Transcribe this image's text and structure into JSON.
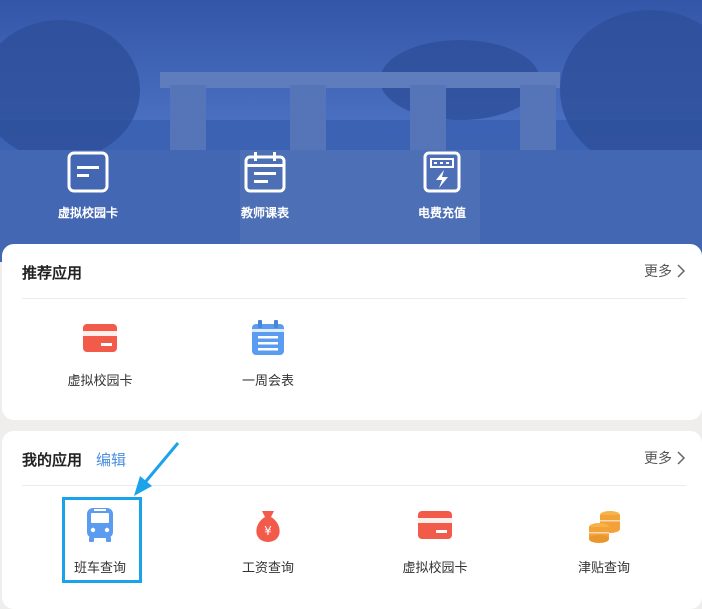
{
  "hero": {
    "quick_actions": [
      {
        "label": "虚拟校园卡",
        "icon": "card-icon"
      },
      {
        "label": "教师课表",
        "icon": "calendar-icon"
      },
      {
        "label": "电费充值",
        "icon": "electric-meter-icon"
      }
    ]
  },
  "recommended": {
    "title": "推荐应用",
    "more_label": "更多",
    "apps": [
      {
        "label": "虚拟校园卡",
        "icon": "card-icon"
      },
      {
        "label": "一周会表",
        "icon": "calendar-list-icon"
      }
    ]
  },
  "my_apps": {
    "title": "我的应用",
    "edit_label": "编辑",
    "more_label": "更多",
    "apps": [
      {
        "label": "班车查询",
        "icon": "bus-icon"
      },
      {
        "label": "工资查询",
        "icon": "money-bag-icon"
      },
      {
        "label": "虚拟校园卡",
        "icon": "card-icon"
      },
      {
        "label": "津贴查询",
        "icon": "coins-icon"
      }
    ]
  },
  "colors": {
    "hero_blue": "#3d62b4",
    "red_icon": "#f25a4a",
    "blue_icon": "#5b9cf0",
    "orange_icon": "#f3a23a",
    "highlight": "#1aa3ea",
    "link": "#4a8fe0"
  }
}
